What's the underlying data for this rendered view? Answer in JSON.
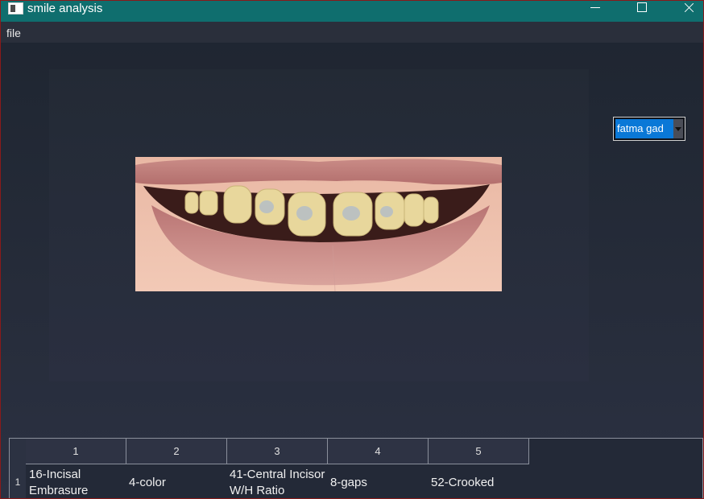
{
  "window": {
    "title": "smile analysis"
  },
  "menu": {
    "file": "file"
  },
  "patient_selector": {
    "value": "fatma gad"
  },
  "table": {
    "row_label": "1",
    "columns": [
      "1",
      "2",
      "3",
      "4",
      "5"
    ],
    "row": [
      "16-Incisal Embrasure",
      "4-color",
      "41-Central Incisor W/H Ratio",
      "8-gaps",
      "52-Crooked"
    ]
  },
  "colors": {
    "titlebar": "#0f6e6e",
    "selection": "#0a78d7",
    "window_border": "#8a1a1a"
  }
}
